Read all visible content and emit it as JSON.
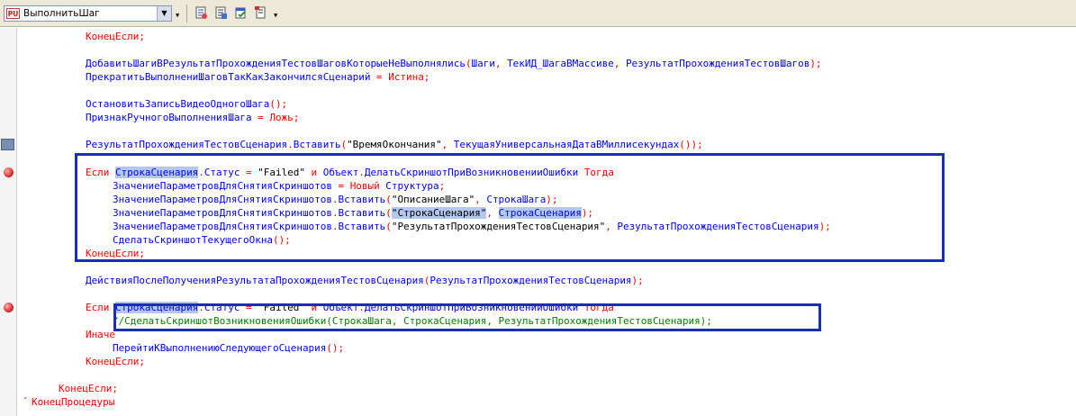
{
  "toolbar": {
    "procedure_icon": "PU",
    "procedure_name": "ВыполнитьШаг",
    "icons": [
      "module-structure-icon",
      "procedures-list-icon",
      "syntax-check-icon",
      "template-icon"
    ]
  },
  "code_lines": [
    {
      "line": 0,
      "indent": 8,
      "tokens": [
        [
          "kw",
          "КонецЕсли"
        ],
        [
          "op",
          ";"
        ]
      ]
    },
    {
      "line": 2,
      "indent": 8,
      "tokens": [
        [
          "id",
          "ДобавитьШагиВРезультатПрохожденияТестовШаговКоторыеНеВыполнялись"
        ],
        [
          "op",
          "("
        ],
        [
          "id",
          "Шаги"
        ],
        [
          "op",
          ", "
        ],
        [
          "id",
          "ТекИД_ШагаВМассиве"
        ],
        [
          "op",
          ", "
        ],
        [
          "id",
          "РезультатПрохожденияТестовШагов"
        ],
        [
          "op",
          ");"
        ]
      ]
    },
    {
      "line": 3,
      "indent": 8,
      "tokens": [
        [
          "id",
          "ПрекратитьВыполнениШаговТакКакЗакончилсяСценарий"
        ],
        [
          "op",
          " = "
        ],
        [
          "kw",
          "Истина"
        ],
        [
          "op",
          ";"
        ]
      ]
    },
    {
      "line": 5,
      "indent": 8,
      "tokens": [
        [
          "id",
          "ОстановитьЗаписьВидеоОдногоШага"
        ],
        [
          "op",
          "();"
        ]
      ]
    },
    {
      "line": 6,
      "indent": 8,
      "tokens": [
        [
          "id",
          "ПризнакРучногоВыполненияШага"
        ],
        [
          "op",
          " = "
        ],
        [
          "kw",
          "Ложь"
        ],
        [
          "op",
          ";"
        ]
      ]
    },
    {
      "line": 8,
      "indent": 8,
      "tokens": [
        [
          "id",
          "РезультатПрохожденияТестовСценария"
        ],
        [
          "op",
          "."
        ],
        [
          "id",
          "Вставить"
        ],
        [
          "op",
          "("
        ],
        [
          "st",
          "\"ВремяОкончания\""
        ],
        [
          "op",
          ", "
        ],
        [
          "id",
          "ТекущаяУниверсальнаяДатаВМиллисекундах"
        ],
        [
          "op",
          "());"
        ]
      ]
    },
    {
      "line": 10,
      "indent": 8,
      "tokens": [
        [
          "kw",
          "Если "
        ],
        [
          "idsel",
          "СтрокаСценария"
        ],
        [
          "op",
          "."
        ],
        [
          "id",
          "Статус"
        ],
        [
          "op",
          " = "
        ],
        [
          "st",
          "\"Failed\""
        ],
        [
          "kw",
          " и "
        ],
        [
          "id",
          "Объект"
        ],
        [
          "op",
          "."
        ],
        [
          "id",
          "ДелатьСкриншотПриВозникновенииОшибки"
        ],
        [
          "kw",
          " Тогда"
        ]
      ]
    },
    {
      "line": 11,
      "indent": 12,
      "tokens": [
        [
          "id",
          "ЗначениеПараметровДляСнятияСкриншотов"
        ],
        [
          "op",
          " = "
        ],
        [
          "kw",
          "Новый "
        ],
        [
          "id",
          "Структура"
        ],
        [
          "op",
          ";"
        ]
      ]
    },
    {
      "line": 12,
      "indent": 12,
      "tokens": [
        [
          "id",
          "ЗначениеПараметровДляСнятияСкриншотов"
        ],
        [
          "op",
          "."
        ],
        [
          "id",
          "Вставить"
        ],
        [
          "op",
          "("
        ],
        [
          "st",
          "\"ОписаниеШага\""
        ],
        [
          "op",
          ", "
        ],
        [
          "id",
          "СтрокаШага"
        ],
        [
          "op",
          ");"
        ]
      ]
    },
    {
      "line": 13,
      "indent": 12,
      "tokens": [
        [
          "id",
          "ЗначениеПараметровДляСнятияСкриншотов"
        ],
        [
          "op",
          "."
        ],
        [
          "id",
          "Вставить"
        ],
        [
          "op",
          "("
        ],
        [
          "stsel",
          "\"СтрокаСценария\""
        ],
        [
          "op",
          ", "
        ],
        [
          "idsel",
          "СтрокаСценария"
        ],
        [
          "op",
          ");"
        ]
      ]
    },
    {
      "line": 14,
      "indent": 12,
      "tokens": [
        [
          "id",
          "ЗначениеПараметровДляСнятияСкриншотов"
        ],
        [
          "op",
          "."
        ],
        [
          "id",
          "Вставить"
        ],
        [
          "op",
          "("
        ],
        [
          "st",
          "\"РезультатПрохожденияТестовСценария\""
        ],
        [
          "op",
          ", "
        ],
        [
          "id",
          "РезультатПрохожденияТестовСценария"
        ],
        [
          "op",
          ");"
        ]
      ]
    },
    {
      "line": 15,
      "indent": 12,
      "tokens": [
        [
          "id",
          "СделатьСкриншотТекущегоОкна"
        ],
        [
          "op",
          "();"
        ]
      ]
    },
    {
      "line": 16,
      "indent": 8,
      "tokens": [
        [
          "kw",
          "КонецЕсли"
        ],
        [
          "op",
          ";"
        ]
      ]
    },
    {
      "line": 18,
      "indent": 8,
      "tokens": [
        [
          "id",
          "ДействияПослеПолученияРезультатаПрохожденияТестовСценария"
        ],
        [
          "op",
          "("
        ],
        [
          "id",
          "РезультатПрохожденияТестовСценария"
        ],
        [
          "op",
          ");"
        ]
      ]
    },
    {
      "line": 20,
      "indent": 8,
      "tokens": [
        [
          "kw",
          "Если "
        ],
        [
          "idsel",
          "СтрокаСценария"
        ],
        [
          "op",
          "."
        ],
        [
          "id",
          "Статус"
        ],
        [
          "op",
          " = "
        ],
        [
          "st",
          "\"Failed\""
        ],
        [
          "kw",
          " и "
        ],
        [
          "id",
          "Объект"
        ],
        [
          "op",
          "."
        ],
        [
          "id",
          "ДелатьСкриншотПриВозникновенииОшибки"
        ],
        [
          "kw",
          " Тогда"
        ]
      ]
    },
    {
      "line": 21,
      "indent": 12,
      "tokens": [
        [
          "cm",
          "//СделатьСкриншотВозникновенияОшибки(СтрокаШага, СтрокаСценария, РезультатПрохожденияТестовСценария);"
        ]
      ]
    },
    {
      "line": 22,
      "indent": 8,
      "tokens": [
        [
          "kw",
          "Иначе"
        ]
      ]
    },
    {
      "line": 23,
      "indent": 12,
      "tokens": [
        [
          "id",
          "ПерейтиКВыполнениюСледующегоСценария"
        ],
        [
          "op",
          "();"
        ]
      ]
    },
    {
      "line": 24,
      "indent": 8,
      "tokens": [
        [
          "kw",
          "КонецЕсли"
        ],
        [
          "op",
          ";"
        ]
      ]
    },
    {
      "line": 26,
      "indent": 4,
      "tokens": [
        [
          "kw",
          "КонецЕсли"
        ],
        [
          "op",
          ";"
        ]
      ]
    },
    {
      "line": 27,
      "indent": 0,
      "tokens": [
        [
          "kw",
          "КонецПроцедуры"
        ]
      ]
    }
  ],
  "gutter_markers": [
    {
      "type": "bookmark",
      "line": 8
    },
    {
      "type": "breakpoint",
      "line": 10
    },
    {
      "type": "breakpoint",
      "line": 20
    }
  ],
  "colors": {
    "keyword": "#ff0000",
    "identifier": "#0000ff",
    "string": "#000000",
    "comment": "#008000",
    "selection": "#b4c8ec",
    "annotation_box": "#1b2fb4"
  }
}
